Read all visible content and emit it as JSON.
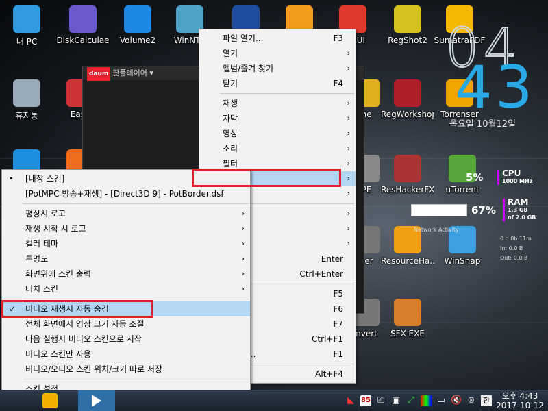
{
  "desktop_icons": [
    {
      "label": "내 PC",
      "icon": "computer-icon",
      "color": "#2f9be0"
    },
    {
      "label": "DiskCalculae",
      "icon": "pie-chart-icon",
      "color": "#6a5acd"
    },
    {
      "label": "Volume2",
      "icon": "volume-icon",
      "color": "#1e88e5"
    },
    {
      "label": "WinNTS",
      "icon": "windows-setup-icon",
      "color": "#4fa3c7"
    },
    {
      "label": "",
      "icon": "gear-icon",
      "color": "#1f4ea0"
    },
    {
      "label": "",
      "icon": "search-document-icon",
      "color": "#f29b1d"
    },
    {
      "label": "exGUI",
      "icon": "windows-logo-icon",
      "color": "#e23b2e"
    },
    {
      "label": "RegShot2",
      "icon": "cubes-icon",
      "color": "#d6c21c"
    },
    {
      "label": "SumatraPDF",
      "icon": "pdf-icon",
      "color": "#f5b800"
    },
    {
      "label": "휴지통",
      "icon": "recycle-bin-icon",
      "color": "#9ab"
    },
    {
      "label": "Easy",
      "icon": "easy-icon",
      "color": "#c33"
    },
    {
      "label": "ne",
      "icon": "flower-icon",
      "color": "#e0b020"
    },
    {
      "label": "RegWorkshop",
      "icon": "reg-cubes-icon",
      "color": "#b01e2a"
    },
    {
      "label": "Torrenser",
      "icon": "duck-icon",
      "color": "#f2a400"
    },
    {
      "label": "",
      "icon": "internet-explorer-icon",
      "color": "#1c8fe0"
    },
    {
      "label": "",
      "icon": "orange-app-icon",
      "color": "#ef6a1a"
    },
    {
      "label": "PE",
      "icon": "pe-icon",
      "color": "#888"
    },
    {
      "label": "ResHackerFX",
      "icon": "hammer-icon",
      "color": "#a33"
    },
    {
      "label": "uTorrent",
      "icon": "utorrent-icon",
      "color": "#58a53a"
    },
    {
      "label": "yer",
      "icon": "player-icon",
      "color": "#777"
    },
    {
      "label": "ResourceHa...",
      "icon": "rh-icon",
      "color": "#f0a010"
    },
    {
      "label": "WinSnap",
      "icon": "winsnap-icon",
      "color": "#3aa0e0"
    },
    {
      "label": "nvert",
      "icon": "convert-icon",
      "color": "#777"
    },
    {
      "label": "SFX-EXE",
      "icon": "box-icon",
      "color": "#d97f2a"
    }
  ],
  "clock_widget": {
    "hour": "04",
    "minute": "43",
    "date": "목요일 10월12일"
  },
  "system": {
    "cpu_value": "5%",
    "cpu_label": "CPU",
    "cpu_sub": "1000 MHz",
    "ram_value": "67%",
    "ram_label": "RAM",
    "ram_sub1": "1.3 GB",
    "ram_sub2": "of 2.0 GB",
    "network_label": "Network Activity",
    "net_time": "0 d 0h 11m",
    "net_in": "In: 0.0 B",
    "net_out": "Out: 0.0 B"
  },
  "potplayer_window": {
    "title": "팟플레이어 ▾",
    "logo": "daum"
  },
  "main_menu": {
    "items": [
      {
        "label": "파일 열기...",
        "shortcut": "F3",
        "arrow": ""
      },
      {
        "label": "열기",
        "shortcut": "",
        "arrow": "›"
      },
      {
        "label": "앨범/즐겨 찾기",
        "shortcut": "",
        "arrow": "›"
      },
      {
        "label": "닫기",
        "shortcut": "F4",
        "arrow": ""
      },
      {
        "sep": true
      },
      {
        "label": "재생",
        "shortcut": "",
        "arrow": "›"
      },
      {
        "label": "자막",
        "shortcut": "",
        "arrow": "›"
      },
      {
        "label": "영상",
        "shortcut": "",
        "arrow": "›"
      },
      {
        "label": "소리",
        "shortcut": "",
        "arrow": "›"
      },
      {
        "label": "필터",
        "shortcut": "",
        "arrow": "›"
      },
      {
        "label": "",
        "shortcut": "",
        "arrow": "›",
        "highlight": true
      },
      {
        "label": "어/기타",
        "shortcut": "",
        "arrow": "›"
      },
      {
        "sep": true
      },
      {
        "label": "캔",
        "shortcut": "",
        "arrow": "›"
      },
      {
        "label": "율",
        "shortcut": "",
        "arrow": "›"
      },
      {
        "label": "기",
        "shortcut": "",
        "arrow": "›"
      },
      {
        "label": "면",
        "shortcut": "Enter",
        "arrow": ""
      },
      {
        "label": "면",
        "shortcut": "Ctrl+Enter",
        "arrow": ""
      },
      {
        "sep": true
      },
      {
        "label": "정...",
        "shortcut": "F5",
        "arrow": ""
      },
      {
        "label": "록...",
        "shortcut": "F6",
        "arrow": ""
      },
      {
        "label": "",
        "shortcut": "F7",
        "arrow": ""
      },
      {
        "label": "보...",
        "shortcut": "Ctrl+F1",
        "arrow": ""
      },
      {
        "label": "램 정보...",
        "shortcut": "F1",
        "arrow": ""
      },
      {
        "sep": true
      },
      {
        "label": "",
        "shortcut": "Alt+F4",
        "arrow": ""
      }
    ]
  },
  "skin_menu": {
    "items": [
      {
        "label": "[내장 스킨]",
        "mark": "•",
        "arrow": ""
      },
      {
        "label": "[PotMPC 방송+재생] - [Direct3D 9] - PotBorder.dsf",
        "mark": "",
        "arrow": ""
      },
      {
        "sep": true
      },
      {
        "label": "평상시 로고",
        "mark": "",
        "arrow": "›"
      },
      {
        "label": "재생 시작 시 로고",
        "mark": "",
        "arrow": "›"
      },
      {
        "label": "컬러 테마",
        "mark": "",
        "arrow": "›"
      },
      {
        "label": "투명도",
        "mark": "",
        "arrow": "›"
      },
      {
        "label": "화면위에 스킨 출력",
        "mark": "",
        "arrow": "›"
      },
      {
        "label": "터치 스킨",
        "mark": "",
        "arrow": "›"
      },
      {
        "sep": true
      },
      {
        "label": "비디오 재생시 자동 숨김",
        "mark": "✓",
        "arrow": "",
        "highlight": true
      },
      {
        "label": "전체 화면에서 영상 크기 자동 조절",
        "mark": "",
        "arrow": ""
      },
      {
        "label": "다음 실행시 비디오 스킨으로 시작",
        "mark": "",
        "arrow": ""
      },
      {
        "label": "비디오 스킨만 사용",
        "mark": "",
        "arrow": ""
      },
      {
        "label": "비디오/오디오 스킨 위치/크기 따로 저장",
        "mark": "",
        "arrow": ""
      },
      {
        "sep": true
      },
      {
        "label": "스킨 설정...",
        "mark": "",
        "arrow": ""
      }
    ]
  },
  "taskbar": {
    "badge": "85",
    "ime": "한",
    "time": "오후 4:43",
    "date": "2017-10-12"
  }
}
